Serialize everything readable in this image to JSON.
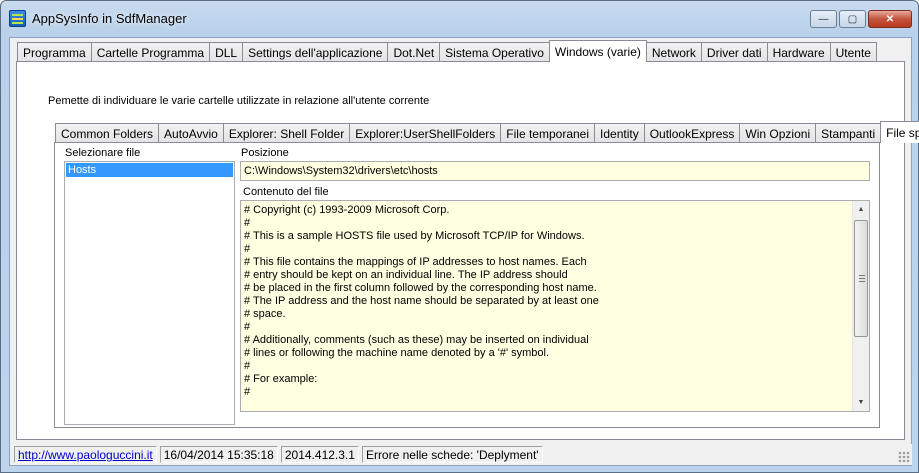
{
  "window": {
    "title": "AppSysInfo in SdfManager"
  },
  "caption_buttons": {
    "minimize": "—",
    "maximize": "▢",
    "close": "✕"
  },
  "main_tabs": [
    {
      "label": "Programma",
      "active": false
    },
    {
      "label": "Cartelle Programma",
      "active": false
    },
    {
      "label": "DLL",
      "active": false
    },
    {
      "label": "Settings dell'applicazione",
      "active": false
    },
    {
      "label": "Dot.Net",
      "active": false
    },
    {
      "label": "Sistema Operativo",
      "active": false
    },
    {
      "label": "Windows (varie)",
      "active": true
    },
    {
      "label": "Network",
      "active": false
    },
    {
      "label": "Driver dati",
      "active": false
    },
    {
      "label": "Hardware",
      "active": false
    },
    {
      "label": "Utente",
      "active": false
    }
  ],
  "description": "Pemette di individuare le varie cartelle utilizzate in relazione all'utente corrente",
  "sub_tabs": [
    {
      "label": "Common Folders",
      "active": false
    },
    {
      "label": "AutoAvvio",
      "active": false
    },
    {
      "label": "Explorer: Shell Folder",
      "active": false
    },
    {
      "label": "Explorer:UserShellFolders",
      "active": false
    },
    {
      "label": "File temporanei",
      "active": false
    },
    {
      "label": "Identity",
      "active": false
    },
    {
      "label": "OutlookExpress",
      "active": false
    },
    {
      "label": "Win Opzioni",
      "active": false
    },
    {
      "label": "Stampanti",
      "active": false
    },
    {
      "label": "File speciali",
      "active": true
    }
  ],
  "file_panel": {
    "select_label": "Selezionare file",
    "files": [
      "Hosts"
    ],
    "position_label": "Posizione",
    "position_value": "C:\\Windows\\System32\\drivers\\etc\\hosts",
    "content_label": "Contenuto del file",
    "content_lines": [
      "# Copyright (c) 1993-2009 Microsoft Corp.",
      "#",
      "# This is a sample HOSTS file used by Microsoft TCP/IP for Windows.",
      "#",
      "# This file contains the mappings of IP addresses to host names. Each",
      "# entry should be kept on an individual line. The IP address should",
      "# be placed in the first column followed by the corresponding host name.",
      "# The IP address and the host name should be separated by at least one",
      "# space.",
      "#",
      "# Additionally, comments (such as these) may be inserted on individual",
      "# lines or following the machine name denoted by a '#' symbol.",
      "#",
      "# For example:",
      "#"
    ]
  },
  "statusbar": {
    "link": "http://www.paologuccini.it",
    "datetime": "16/04/2014 15:35:18",
    "version": "2014.412.3.1",
    "message": "Errore nelle schede: 'Deplyment'"
  }
}
